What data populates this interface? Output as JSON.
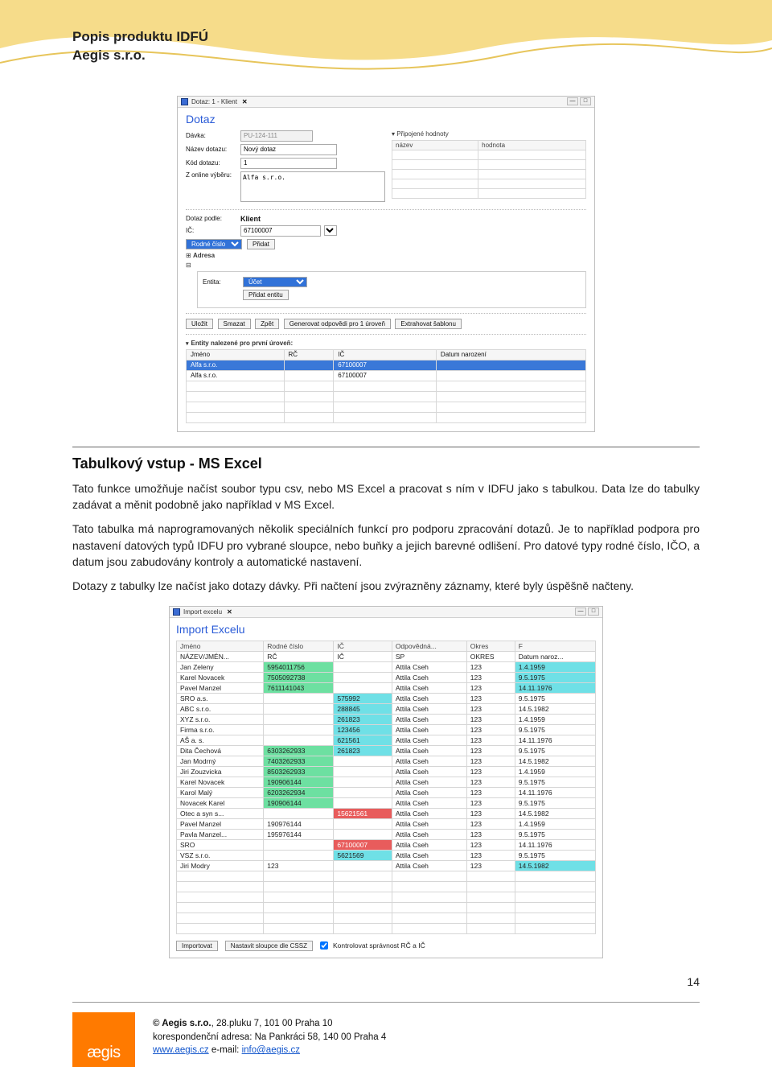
{
  "header": {
    "line1": "Popis produktu IDFÚ",
    "line2": "Aegis s.r.o."
  },
  "win1": {
    "tab": "Dotaz: 1 - Klient",
    "close": "✕",
    "heading": "Dotaz",
    "labels": {
      "davka": "Dávka:",
      "nazev_dotazu": "Název dotazu:",
      "kod_dotazu": "Kód dotazu:",
      "z_online": "Z online výběru:",
      "pripojene": "Připojené hodnoty",
      "th_nazev": "název",
      "th_hodnota": "hodnota",
      "dotaz_podle": "Dotaz podle:",
      "dotaz_podle_val": "Klient",
      "ic": "IČ:",
      "rodne_cislo": "Rodné číslo",
      "pridat": "Přidat",
      "adresa": "Adresa",
      "entita": "Entita:",
      "entita_opt": "Účet",
      "pridat_entitu": "Přidat entitu"
    },
    "values": {
      "davka": "PU-124-111",
      "nazev_dotazu": "Nový dotaz",
      "kod_dotazu": "1",
      "z_online": "Alfa s.r.o.",
      "ic": "67100007"
    },
    "buttons": {
      "ulozit": "Uložit",
      "smazat": "Smazat",
      "zpet": "Zpět",
      "gen": "Generovat odpovědi pro 1 úroveň",
      "ext": "Extrahovat šablonu"
    },
    "results": {
      "label": "Entity nalezené pro první úroveň:",
      "cols": {
        "jmeno": "Jméno",
        "rc": "RČ",
        "ic": "IČ",
        "datum": "Datum narození"
      },
      "rows": [
        {
          "jmeno": "Alfa s.r.o.",
          "rc": "",
          "ic": "67100007",
          "datum": "",
          "sel": true
        },
        {
          "jmeno": "Alfa s.r.o.",
          "rc": "",
          "ic": "67100007",
          "datum": "",
          "sel": false
        }
      ]
    }
  },
  "article": {
    "title": "Tabulkový vstup - MS Excel",
    "p1": "Tato funkce umožňuje načíst soubor typu csv, nebo MS Excel a pracovat s ním v IDFU jako s tabulkou. Data lze do tabulky zadávat a měnit podobně jako například v MS Excel.",
    "p2": "Tato tabulka má naprogramovaných několik speciálních funkcí pro podporu zpracování dotazů. Je to například podpora pro nastavení datových typů IDFU pro vybrané sloupce, nebo buňky a jejich barevné odlišení. Pro datové typy rodné číslo, IČO, a datum jsou zabudovány kontroly a automatické nastavení.",
    "p3": "Dotazy z tabulky lze načíst jako dotazy dávky. Při načtení jsou zvýrazněny záznamy, které byly úspěšně načteny."
  },
  "win2": {
    "tab": "Import excelu",
    "heading": "Import Excelu",
    "cols": {
      "jmeno": "Jméno",
      "rc": "Rodné číslo",
      "ic": "IČ",
      "odp": "Odpovědná...",
      "okres": "Okres",
      "f": "F"
    },
    "headerRow": {
      "jmeno": "NÁZEV/JMÉN...",
      "rc": "RČ",
      "ic": "IČ",
      "odp": "SP",
      "okres": "OKRES",
      "f": "Datum naroz..."
    },
    "rows": [
      {
        "jmeno": "Jan Zeleny",
        "rc": "5954011756",
        "rc_c": "green",
        "ic": "",
        "odp": "Attila Cseh",
        "okres": "123",
        "f": "1.4.1959",
        "f_c": "cyan"
      },
      {
        "jmeno": "Karel Novacek",
        "rc": "7505092738",
        "rc_c": "green",
        "ic": "",
        "odp": "Attila Cseh",
        "okres": "123",
        "f": "9.5.1975",
        "f_c": "cyan"
      },
      {
        "jmeno": "Pavel Manzel",
        "rc": "7611141043",
        "rc_c": "green",
        "ic": "",
        "odp": "Attila Cseh",
        "okres": "123",
        "f": "14.11.1976",
        "f_c": "cyan"
      },
      {
        "jmeno": "SRO a.s.",
        "rc": "",
        "ic": "575992",
        "ic_c": "cyan",
        "odp": "Attila Cseh",
        "okres": "123",
        "f": "9.5.1975"
      },
      {
        "jmeno": "ABC s.r.o.",
        "rc": "",
        "ic": "288845",
        "ic_c": "cyan",
        "odp": "Attila Cseh",
        "okres": "123",
        "f": "14.5.1982"
      },
      {
        "jmeno": "XYZ s.r.o.",
        "rc": "",
        "ic": "261823",
        "ic_c": "cyan",
        "odp": "Attila Cseh",
        "okres": "123",
        "f": "1.4.1959"
      },
      {
        "jmeno": "Firma s.r.o.",
        "rc": "",
        "ic": "123456",
        "ic_c": "cyan",
        "odp": "Attila Cseh",
        "okres": "123",
        "f": "9.5.1975"
      },
      {
        "jmeno": "AŠ a. s.",
        "rc": "",
        "ic": "621561",
        "ic_c": "cyan",
        "odp": "Attila Cseh",
        "okres": "123",
        "f": "14.11.1976"
      },
      {
        "jmeno": "Dita Čechová",
        "rc": "6303262933",
        "rc_c": "green",
        "ic": "261823",
        "ic_c": "cyan",
        "odp": "Attila Cseh",
        "okres": "123",
        "f": "9.5.1975"
      },
      {
        "jmeno": "Jan Modrný",
        "rc": "7403262933",
        "rc_c": "green",
        "ic": "",
        "odp": "Attila Cseh",
        "okres": "123",
        "f": "14.5.1982"
      },
      {
        "jmeno": "Jiri Zouzvicka",
        "rc": "8503262933",
        "rc_c": "green",
        "ic": "",
        "odp": "Attila Cseh",
        "okres": "123",
        "f": "1.4.1959"
      },
      {
        "jmeno": "Karel Novacek",
        "rc": "190906144",
        "rc_c": "green",
        "ic": "",
        "odp": "Attila Cseh",
        "okres": "123",
        "f": "9.5.1975"
      },
      {
        "jmeno": "Karol Malý",
        "rc": "6203262934",
        "rc_c": "green",
        "ic": "",
        "odp": "Attila Cseh",
        "okres": "123",
        "f": "14.11.1976"
      },
      {
        "jmeno": "Novacek Karel",
        "rc": "190906144",
        "rc_c": "green",
        "ic": "",
        "odp": "Attila Cseh",
        "okres": "123",
        "f": "9.5.1975"
      },
      {
        "jmeno": "Otec a syn s...",
        "rc": "",
        "ic": "15621561",
        "ic_c": "red",
        "odp": "Attila Cseh",
        "okres": "123",
        "f": "14.5.1982"
      },
      {
        "jmeno": "Pavel Manzel",
        "rc": "190976144",
        "ic": "",
        "odp": "Attila Cseh",
        "okres": "123",
        "f": "1.4.1959"
      },
      {
        "jmeno": "Pavla Manzel...",
        "rc": "195976144",
        "ic": "",
        "odp": "Attila Cseh",
        "okres": "123",
        "f": "9.5.1975"
      },
      {
        "jmeno": "SRO",
        "rc": "",
        "ic": "67100007",
        "ic_c": "red",
        "odp": "Attila Cseh",
        "okres": "123",
        "f": "14.11.1976"
      },
      {
        "jmeno": "VSZ s.r.o.",
        "rc": "",
        "ic": "5621569",
        "ic_c": "cyan",
        "odp": "Attila Cseh",
        "okres": "123",
        "f": "9.5.1975"
      },
      {
        "jmeno": "Jiri Modry",
        "rc": "123",
        "ic": "",
        "odp": "Attila Cseh",
        "okres": "123",
        "f": "14.5.1982",
        "f_c": "cyan"
      }
    ],
    "footer": {
      "importovat": "Importovat",
      "nastavit": "Nastavit sloupce dle CSSZ",
      "checkbox": "Kontrolovat správnost RČ a IČ"
    }
  },
  "pageNumber": "14",
  "footer": {
    "logo": "ægis",
    "line1a": "© Aegis s.r.o.",
    "line1b": ", 28.pluku 7, 101 00 Praha 10",
    "line2": "korespondenční adresa: Na Pankráci 58, 140 00 Praha 4",
    "line3a": "www.aegis.cz",
    "line3b": "   e-mail: ",
    "email": "info@aegis.cz"
  }
}
